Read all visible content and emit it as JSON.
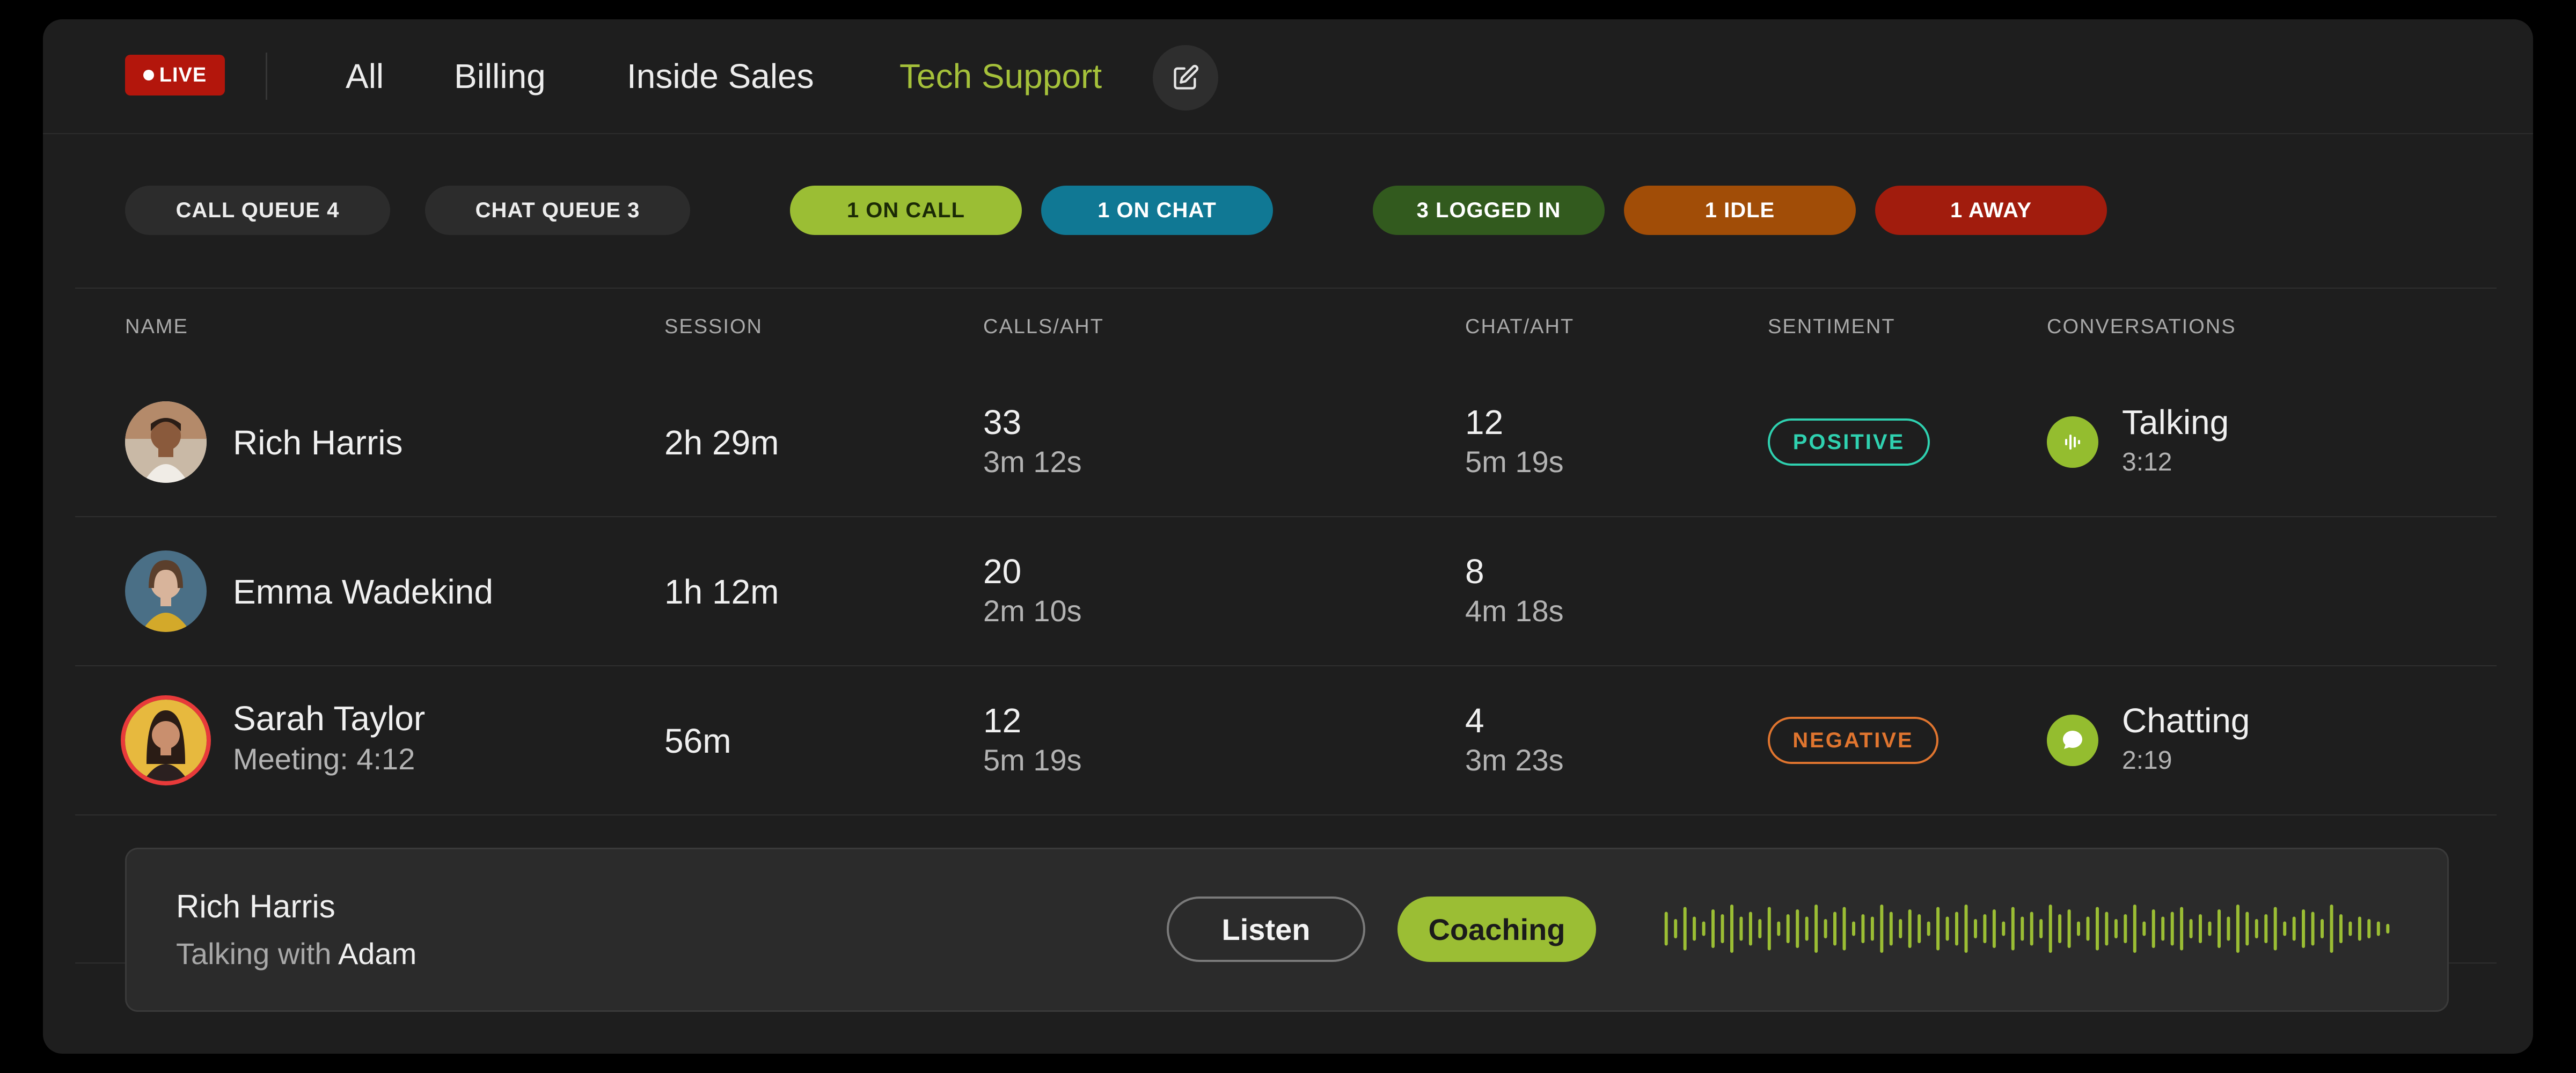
{
  "header": {
    "live_label": "LIVE",
    "tabs": [
      {
        "label": "All",
        "active": false
      },
      {
        "label": "Billing",
        "active": false
      },
      {
        "label": "Inside Sales",
        "active": false
      },
      {
        "label": "Tech Support",
        "active": true
      }
    ],
    "edit_icon": "edit-icon"
  },
  "status_pills": [
    {
      "label": "CALL QUEUE 4",
      "bg": "#2c2c2c",
      "fg": "#ededed"
    },
    {
      "label": "CHAT QUEUE 3",
      "bg": "#2c2c2c",
      "fg": "#ededed"
    },
    {
      "label": "1 ON CALL",
      "bg": "#9bbe34",
      "fg": "#1b2a06"
    },
    {
      "label": "1 ON CHAT",
      "bg": "#107894",
      "fg": "#ffffff"
    },
    {
      "label": "3 LOGGED IN",
      "bg": "#325a1e",
      "fg": "#ffffff"
    },
    {
      "label": "1 IDLE",
      "bg": "#a14d07",
      "fg": "#ffffff"
    },
    {
      "label": "1 AWAY",
      "bg": "#a11c0d",
      "fg": "#ffffff"
    }
  ],
  "table": {
    "columns": [
      "NAME",
      "SESSION",
      "CALLS/AHT",
      "CHAT/AHT",
      "SENTIMENT",
      "CONVERSATIONS"
    ],
    "rows": [
      {
        "name": "Rich Harris",
        "subname": "",
        "session": "2h 29m",
        "calls": "33",
        "calls_aht": "3m 12s",
        "chats": "12",
        "chats_aht": "5m 19s",
        "sentiment": "POSITIVE",
        "conversation": "Talking",
        "conversation_time": "3:12",
        "conversation_icon": "audio-wave-icon"
      },
      {
        "name": "Emma Wadekind",
        "subname": "",
        "session": "1h 12m",
        "calls": "20",
        "calls_aht": "2m 10s",
        "chats": "8",
        "chats_aht": "4m 18s",
        "sentiment": "",
        "conversation": "",
        "conversation_time": ""
      },
      {
        "name": "Sarah Taylor",
        "subname": "Meeting: 4:12",
        "session": "56m",
        "calls": "12",
        "calls_aht": "5m 19s",
        "chats": "4",
        "chats_aht": "3m 23s",
        "sentiment": "NEGATIVE",
        "conversation": "Chatting",
        "conversation_time": "2:19",
        "conversation_icon": "chat-bubble-icon"
      }
    ]
  },
  "colors": {
    "accent": "#a5c13a",
    "positive": "#2fd1b0",
    "negative": "#e0752f"
  },
  "player": {
    "name": "Rich Harris",
    "sub_prefix": "Talking with",
    "sub_contact": "Adam",
    "listen_label": "Listen",
    "coaching_label": "Coaching"
  }
}
